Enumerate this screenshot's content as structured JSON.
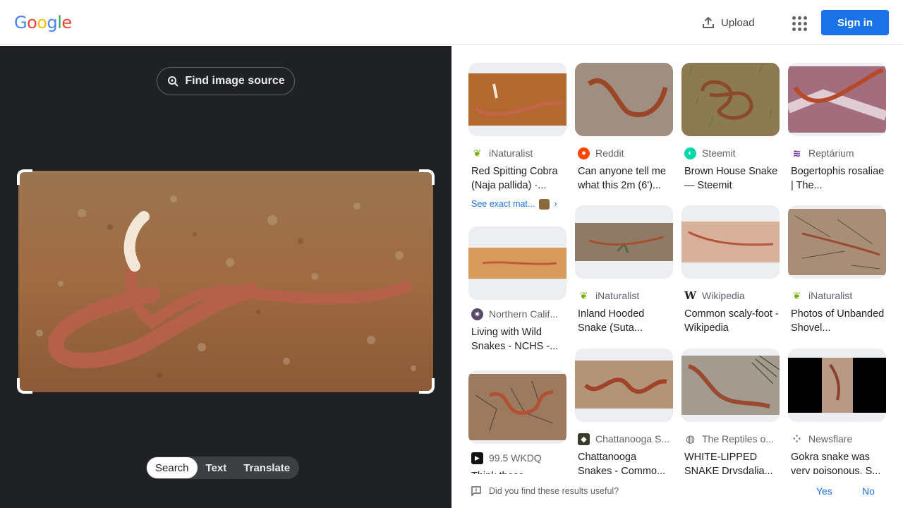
{
  "header": {
    "logo_letters": [
      {
        "ch": "G",
        "color": "#4285f4"
      },
      {
        "ch": "o",
        "color": "#ea4335"
      },
      {
        "ch": "o",
        "color": "#fbbc05"
      },
      {
        "ch": "g",
        "color": "#4285f4"
      },
      {
        "ch": "l",
        "color": "#34a853"
      },
      {
        "ch": "e",
        "color": "#ea4335"
      }
    ],
    "upload_label": "Upload",
    "signin_label": "Sign in"
  },
  "left_panel": {
    "find_source_label": "Find image source",
    "tabs": [
      "Search",
      "Text",
      "Translate"
    ],
    "active_tab": "Search"
  },
  "results": [
    {
      "source": "iNaturalist",
      "icon": "inaturalist-icon",
      "color": "#74ac00",
      "title": "Red Spitting Cobra (Naja pallida) ·...",
      "exact": "See exact mat...",
      "scene": "red-dirt"
    },
    {
      "source": "Reddit",
      "icon": "reddit-icon",
      "color": "#ff4500",
      "title": "Can anyone tell me what this 2m (6')...",
      "scene": "gravel"
    },
    {
      "source": "Steemit",
      "icon": "steemit-icon",
      "color": "#06d6a9",
      "title": "Brown House Snake — Steemit",
      "scene": "grass"
    },
    {
      "source": "Reptárium",
      "icon": "reptarium-icon",
      "color": "#7b2c9f",
      "title": "Bogertophis rosaliae | The...",
      "scene": "rock"
    },
    {
      "source": "Northern Calif...",
      "icon": "nchs-icon",
      "color": "#5a4a6a",
      "title": "Living with Wild Snakes - NCHS -...",
      "scene": "sand"
    },
    {
      "source": "iNaturalist",
      "icon": "inaturalist-icon",
      "color": "#74ac00",
      "title": "Inland Hooded Snake (Suta...",
      "scene": "dry"
    },
    {
      "source": "Wikipedia",
      "icon": "wikipedia-icon",
      "color": "#202124",
      "title": "Common scaly-foot - Wikipedia",
      "scene": "sand2"
    },
    {
      "source": "iNaturalist",
      "icon": "inaturalist-icon",
      "color": "#74ac00",
      "title": "Photos of Unbanded Shovel...",
      "scene": "twigs"
    },
    {
      "source": "99.5 WKDQ",
      "icon": "wkdq-icon",
      "color": "#111111",
      "title": "Think these Snakes...",
      "scene": "cracked"
    },
    {
      "source": "Chattanooga S...",
      "icon": "chattanooga-icon",
      "color": "#3a3a2a",
      "title": "Chattanooga Snakes - Commo...",
      "scene": "tan"
    },
    {
      "source": "The Reptiles o...",
      "icon": "globe-icon",
      "color": "#5f6368",
      "title": "WHITE-LIPPED SNAKE Drysdalia...",
      "scene": "ground"
    },
    {
      "source": "Newsflare",
      "icon": "newsflare-icon",
      "color": "#5f6368",
      "title": "Gokra snake was very poisonous. S...",
      "scene": "video"
    }
  ],
  "feedback": {
    "question": "Did you find these results useful?",
    "yes": "Yes",
    "no": "No"
  }
}
